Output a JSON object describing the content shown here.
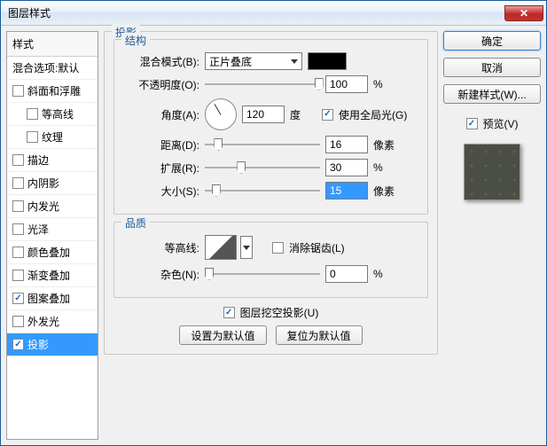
{
  "titlebar": {
    "title": "图层样式"
  },
  "sidebar": {
    "header": "样式",
    "blend_default": "混合选项:默认",
    "items": [
      {
        "label": "斜面和浮雕",
        "checked": false,
        "indent": false
      },
      {
        "label": "等高线",
        "checked": false,
        "indent": true
      },
      {
        "label": "纹理",
        "checked": false,
        "indent": true
      },
      {
        "label": "描边",
        "checked": false,
        "indent": false
      },
      {
        "label": "内阴影",
        "checked": false,
        "indent": false
      },
      {
        "label": "内发光",
        "checked": false,
        "indent": false
      },
      {
        "label": "光泽",
        "checked": false,
        "indent": false
      },
      {
        "label": "颜色叠加",
        "checked": false,
        "indent": false
      },
      {
        "label": "渐变叠加",
        "checked": false,
        "indent": false
      },
      {
        "label": "图案叠加",
        "checked": true,
        "indent": false
      },
      {
        "label": "外发光",
        "checked": false,
        "indent": false
      },
      {
        "label": "投影",
        "checked": true,
        "indent": false,
        "selected": true
      }
    ]
  },
  "main": {
    "group_title": "投影",
    "structure": {
      "legend": "结构",
      "blend_mode_label": "混合模式(B):",
      "blend_mode_value": "正片叠底",
      "opacity_label": "不透明度(O):",
      "opacity_value": "100",
      "percent": "%",
      "angle_label": "角度(A):",
      "angle_value": "120",
      "degree": "度",
      "global_light_label": "使用全局光(G)",
      "global_light_checked": true,
      "distance_label": "距离(D):",
      "distance_value": "16",
      "px": "像素",
      "spread_label": "扩展(R):",
      "spread_value": "30",
      "size_label": "大小(S):",
      "size_value": "15"
    },
    "quality": {
      "legend": "品质",
      "contour_label": "等高线:",
      "antialias_label": "消除锯齿(L)",
      "antialias_checked": false,
      "noise_label": "杂色(N):",
      "noise_value": "0"
    },
    "knockout_label": "图层挖空投影(U)",
    "knockout_checked": true,
    "make_default": "设置为默认值",
    "reset_default": "复位为默认值"
  },
  "right": {
    "ok": "确定",
    "cancel": "取消",
    "new_style": "新建样式(W)...",
    "preview_label": "预览(V)",
    "preview_checked": true
  }
}
